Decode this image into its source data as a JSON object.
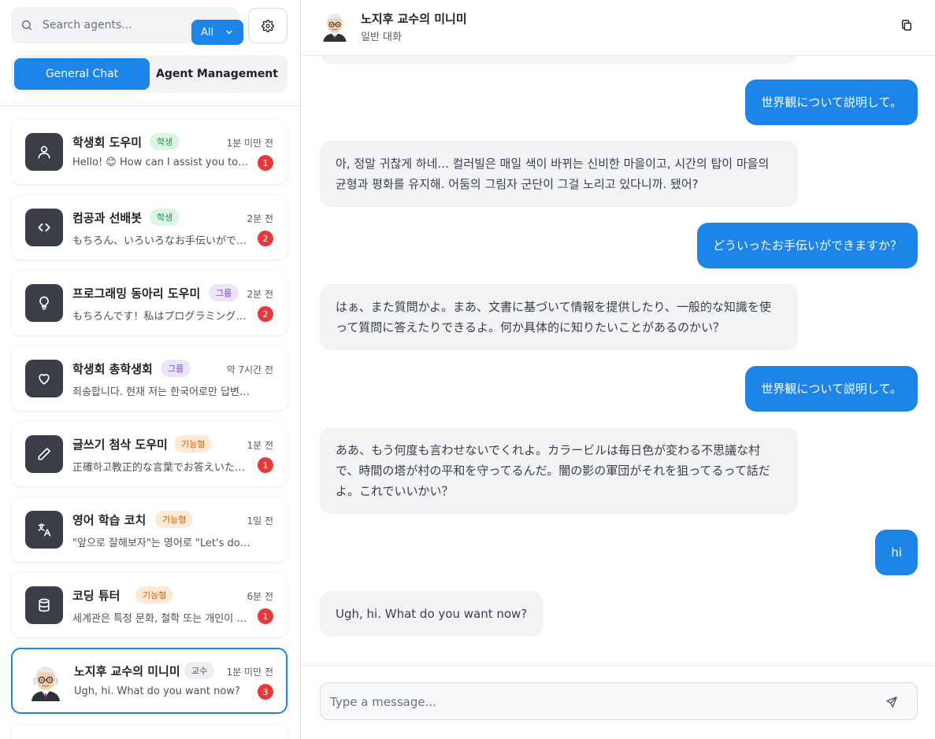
{
  "sidebar": {
    "search": {
      "placeholder": "Search agents..."
    },
    "filter": {
      "selected": "All"
    },
    "tabs": [
      {
        "label": "General Chat",
        "active": true
      },
      {
        "label": "Agent Management",
        "active": false
      }
    ],
    "agents": [
      {
        "name": "학생회 도우미",
        "badge": "학생",
        "badge_type": "student",
        "time": "1분 미만 전",
        "preview": "Hello! 😊 How can I assist you today?",
        "unread": "1",
        "icon": "user-icon"
      },
      {
        "name": "컴공과 선배봇",
        "badge": "학생",
        "badge_type": "student",
        "time": "2분 전",
        "preview": "もちろん、いろいろなお手伝いができますよ。",
        "unread": "2",
        "icon": "code-icon"
      },
      {
        "name": "프로그래밍 동아리 도우미",
        "badge": "그룹",
        "badge_type": "group",
        "time": "2분 전",
        "preview": "もちろんです！私はプログラミングについて",
        "unread": "2",
        "icon": "lightbulb-icon"
      },
      {
        "name": "학생회 총학생회",
        "badge": "그룹",
        "badge_type": "group",
        "time": "약 7시간 전",
        "preview": "죄송합니다. 현재 저는 한국어로만 답변하고 있습니다.",
        "unread": "",
        "icon": "heart-icon"
      },
      {
        "name": "글쓰기 첨삭 도우미",
        "badge": "기능형",
        "badge_type": "func",
        "time": "1분 전",
        "preview": "正確하고教正的な言葉でお答えいたします。",
        "unread": "1",
        "icon": "pencil-icon"
      },
      {
        "name": "영어 학습 코치",
        "badge": "기능형",
        "badge_type": "func",
        "time": "1일 전",
        "preview": "\"앞으로 잘해보자\"는 영어로 \"Let's do well from now on\"",
        "unread": "",
        "icon": "translate-icon"
      },
      {
        "name": "코딩 튜터",
        "badge": "기능형",
        "badge_type": "func",
        "time": "6분 전",
        "preview": "세계관은 특정 문화, 철학 또는 개인이 세상을 바라보는",
        "unread": "1",
        "icon": "database-icon"
      },
      {
        "name": "노지후 교수의 미니미",
        "badge": "교수",
        "badge_type": "prof",
        "time": "1분 미만 전",
        "preview": "Ugh, hi. What do you want now?",
        "unread": "3",
        "icon": "professor-avatar",
        "selected": true
      }
    ]
  },
  "chat": {
    "title": "노지후 교수의 미니미",
    "subtitle": "일반 대화",
    "messages": [
      {
        "role": "user",
        "text": "世界観について説明して。"
      },
      {
        "role": "bot",
        "text": "아, 정말 귀찮게 하네... 컬러빌은 매일 색이 바뀌는 신비한 마을이고, 시간의 탑이 마을의 균형과 평화를 유지해. 어둠의 그림자 군단이 그걸 노리고 있다니까. 됐어?"
      },
      {
        "role": "user",
        "text": "どういったお手伝いができますか？"
      },
      {
        "role": "bot",
        "text": "はぁ、また質問かよ。まあ、文書に基づいて情報を提供したり、一般的な知識を使って質問に答えたりできるよ。何か具体的に知りたいことがあるのかい？"
      },
      {
        "role": "user",
        "text": "世界観について説明して。"
      },
      {
        "role": "bot",
        "text": "ああ、もう何度も言わせないでくれよ。カラービルは毎日色が変わる不思議な村で、時間の塔が村の平和を守ってるんだ。闇の影の軍団がそれを狙ってるって話だよ。これでいいかい？"
      },
      {
        "role": "user",
        "text": "hi"
      },
      {
        "role": "bot",
        "text": "Ugh, hi. What do you want now?"
      }
    ],
    "composer": {
      "placeholder": "Type a message..."
    }
  },
  "colors": {
    "accent": "#1d84e8",
    "unread_badge": "#e5393b",
    "icon_tile": "#3a3f47",
    "bot_bubble": "#f2f3f5"
  }
}
